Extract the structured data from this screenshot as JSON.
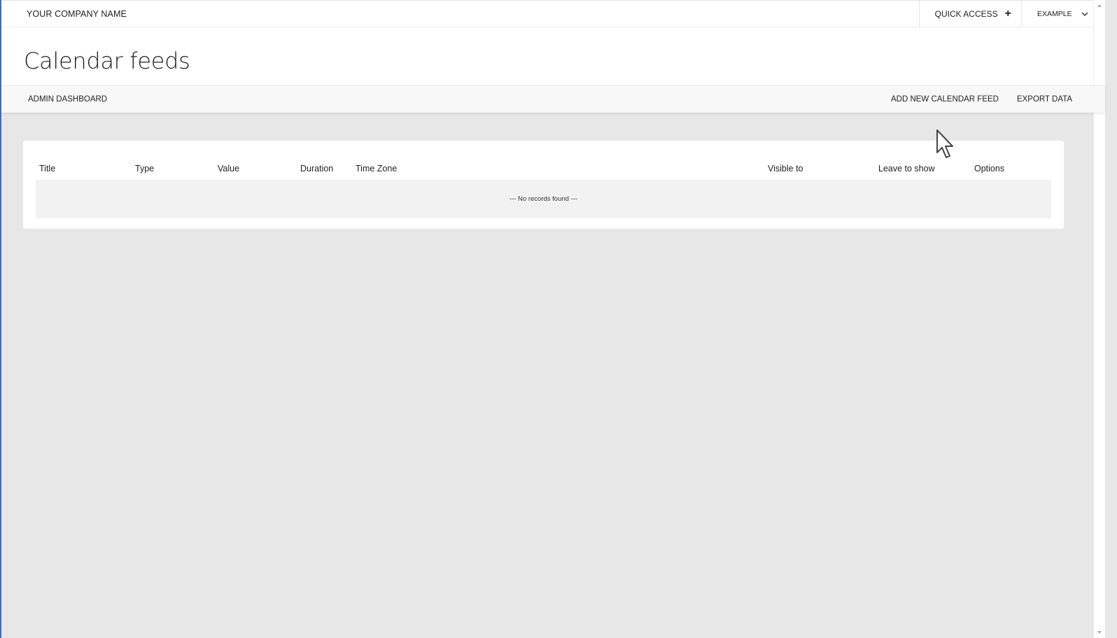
{
  "header": {
    "company_name": "YOUR COMPANY NAME",
    "quick_access_label": "QUICK ACCESS",
    "user_menu_label": "EXAMPLE"
  },
  "page": {
    "title": "Calendar feeds"
  },
  "nav": {
    "admin_dashboard": "ADMIN DASHBOARD",
    "add_feed": "ADD NEW CALENDAR FEED",
    "export_data": "EXPORT DATA"
  },
  "table": {
    "columns": [
      "Title",
      "Type",
      "Value",
      "Duration",
      "Time Zone",
      "Visible to",
      "Leave to show",
      "Options"
    ],
    "empty_message": "--- No records found ---"
  },
  "icons": {
    "quick_access": "plus-icon",
    "user_menu": "chevron-down-icon",
    "pointer": "mouse-cursor-icon"
  },
  "colors": {
    "accent": "#2f6fd6",
    "background": "#e7e7e8"
  }
}
